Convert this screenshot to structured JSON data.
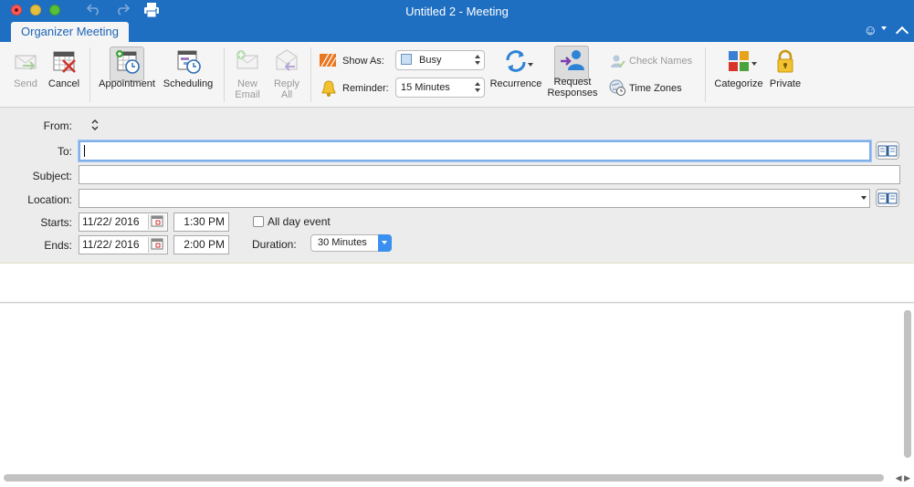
{
  "window": {
    "title": "Untitled 2 - Meeting"
  },
  "ribbon_tab": {
    "label": "Organizer Meeting"
  },
  "ribbon": {
    "send": {
      "label": "Send"
    },
    "cancel": {
      "label": "Cancel"
    },
    "appointment": {
      "label": "Appointment"
    },
    "scheduling": {
      "label": "Scheduling"
    },
    "new_email": {
      "label1": "New",
      "label2": "Email"
    },
    "reply_all": {
      "label1": "Reply",
      "label2": "All"
    },
    "show_as": {
      "label": "Show As:",
      "value": "Busy"
    },
    "reminder": {
      "label": "Reminder:",
      "value": "15 Minutes"
    },
    "recurrence": {
      "label": "Recurrence"
    },
    "request_responses": {
      "label1": "Request",
      "label2": "Responses"
    },
    "check_names": {
      "label": "Check Names"
    },
    "time_zones": {
      "label": "Time Zones"
    },
    "categorize": {
      "label": "Categorize"
    },
    "private": {
      "label": "Private"
    }
  },
  "form": {
    "from": {
      "label": "From:"
    },
    "to": {
      "label": "To:",
      "value": ""
    },
    "subject": {
      "label": "Subject:",
      "value": ""
    },
    "location": {
      "label": "Location:",
      "value": ""
    },
    "starts": {
      "label": "Starts:",
      "date": "11/22/ 2016",
      "time": "1:30 PM"
    },
    "ends": {
      "label": "Ends:",
      "date": "11/22/ 2016",
      "time": "2:00 PM"
    },
    "all_day": {
      "label": "All day event",
      "checked": false
    },
    "duration": {
      "label": "Duration:",
      "value": "30 Minutes"
    }
  },
  "colors": {
    "titlebar": "#1e6fc2",
    "accent": "#3b8ff0"
  }
}
